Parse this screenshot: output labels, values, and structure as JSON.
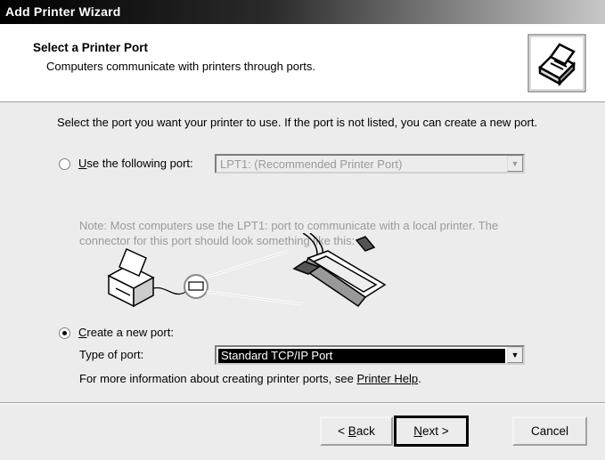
{
  "window": {
    "title": "Add Printer Wizard"
  },
  "header": {
    "title": "Select a Printer Port",
    "subtitle": "Computers communicate with printers through ports.",
    "icon": "printer-icon"
  },
  "body": {
    "intro": "Select the port you want your printer to use.  If the port is not listed, you can create a new port.",
    "use_port": {
      "label_prefix": "",
      "label_mnemonic": "U",
      "label_rest": "se the following port:",
      "selected": false,
      "dropdown_value": "LPT1: (Recommended Printer Port)",
      "disabled": true
    },
    "note": "Note: Most computers use the LPT1: port to communicate with a local printer. The connector for this port should look something like this:",
    "create_port": {
      "label_mnemonic": "C",
      "label_rest": "reate a new port:",
      "selected": true,
      "type_label": "Type of port:",
      "dropdown_value": "Standard TCP/IP Port"
    },
    "help_text": "For more information about creating printer ports, see ",
    "help_link": "Printer Help",
    "help_period": "."
  },
  "buttons": {
    "back_lt": "< ",
    "back_mnemonic": "B",
    "back_rest": "ack",
    "next_mnemonic": "N",
    "next_rest": "ext >",
    "cancel": "Cancel"
  }
}
